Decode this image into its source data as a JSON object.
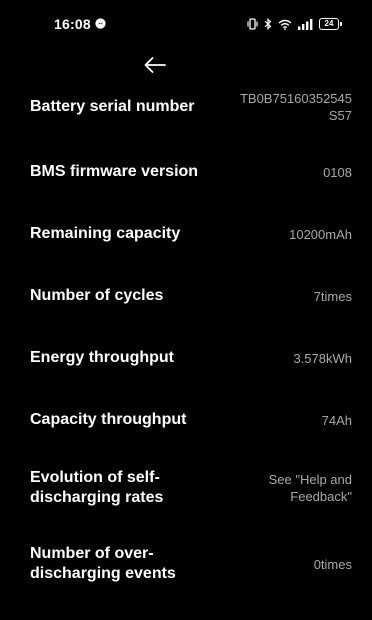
{
  "status_bar": {
    "time": "16:08",
    "battery_level": "24",
    "icons": [
      "messenger-icon",
      "vibrate-icon",
      "bluetooth-icon",
      "wifi-icon",
      "signal-icon",
      "battery-icon"
    ]
  },
  "nav": {
    "back_icon": "arrow-left-icon"
  },
  "rows": [
    {
      "label": "Battery serial number",
      "value": "TB0B75160352545S57"
    },
    {
      "label": "BMS firmware version",
      "value": "0108"
    },
    {
      "label": "Remaining capacity",
      "value": "10200mAh"
    },
    {
      "label": "Number of cycles",
      "value": "7times"
    },
    {
      "label": "Energy throughput",
      "value": "3.578kWh"
    },
    {
      "label": "Capacity throughput",
      "value": "74Ah"
    },
    {
      "label": "Evolution of self-discharging rates",
      "value": "See \"Help and Feedback\""
    },
    {
      "label": "Number of over-discharging events",
      "value": "0times"
    }
  ],
  "colors": {
    "background": "#000000",
    "label": "#ffffff",
    "value": "#a8a8a8"
  }
}
